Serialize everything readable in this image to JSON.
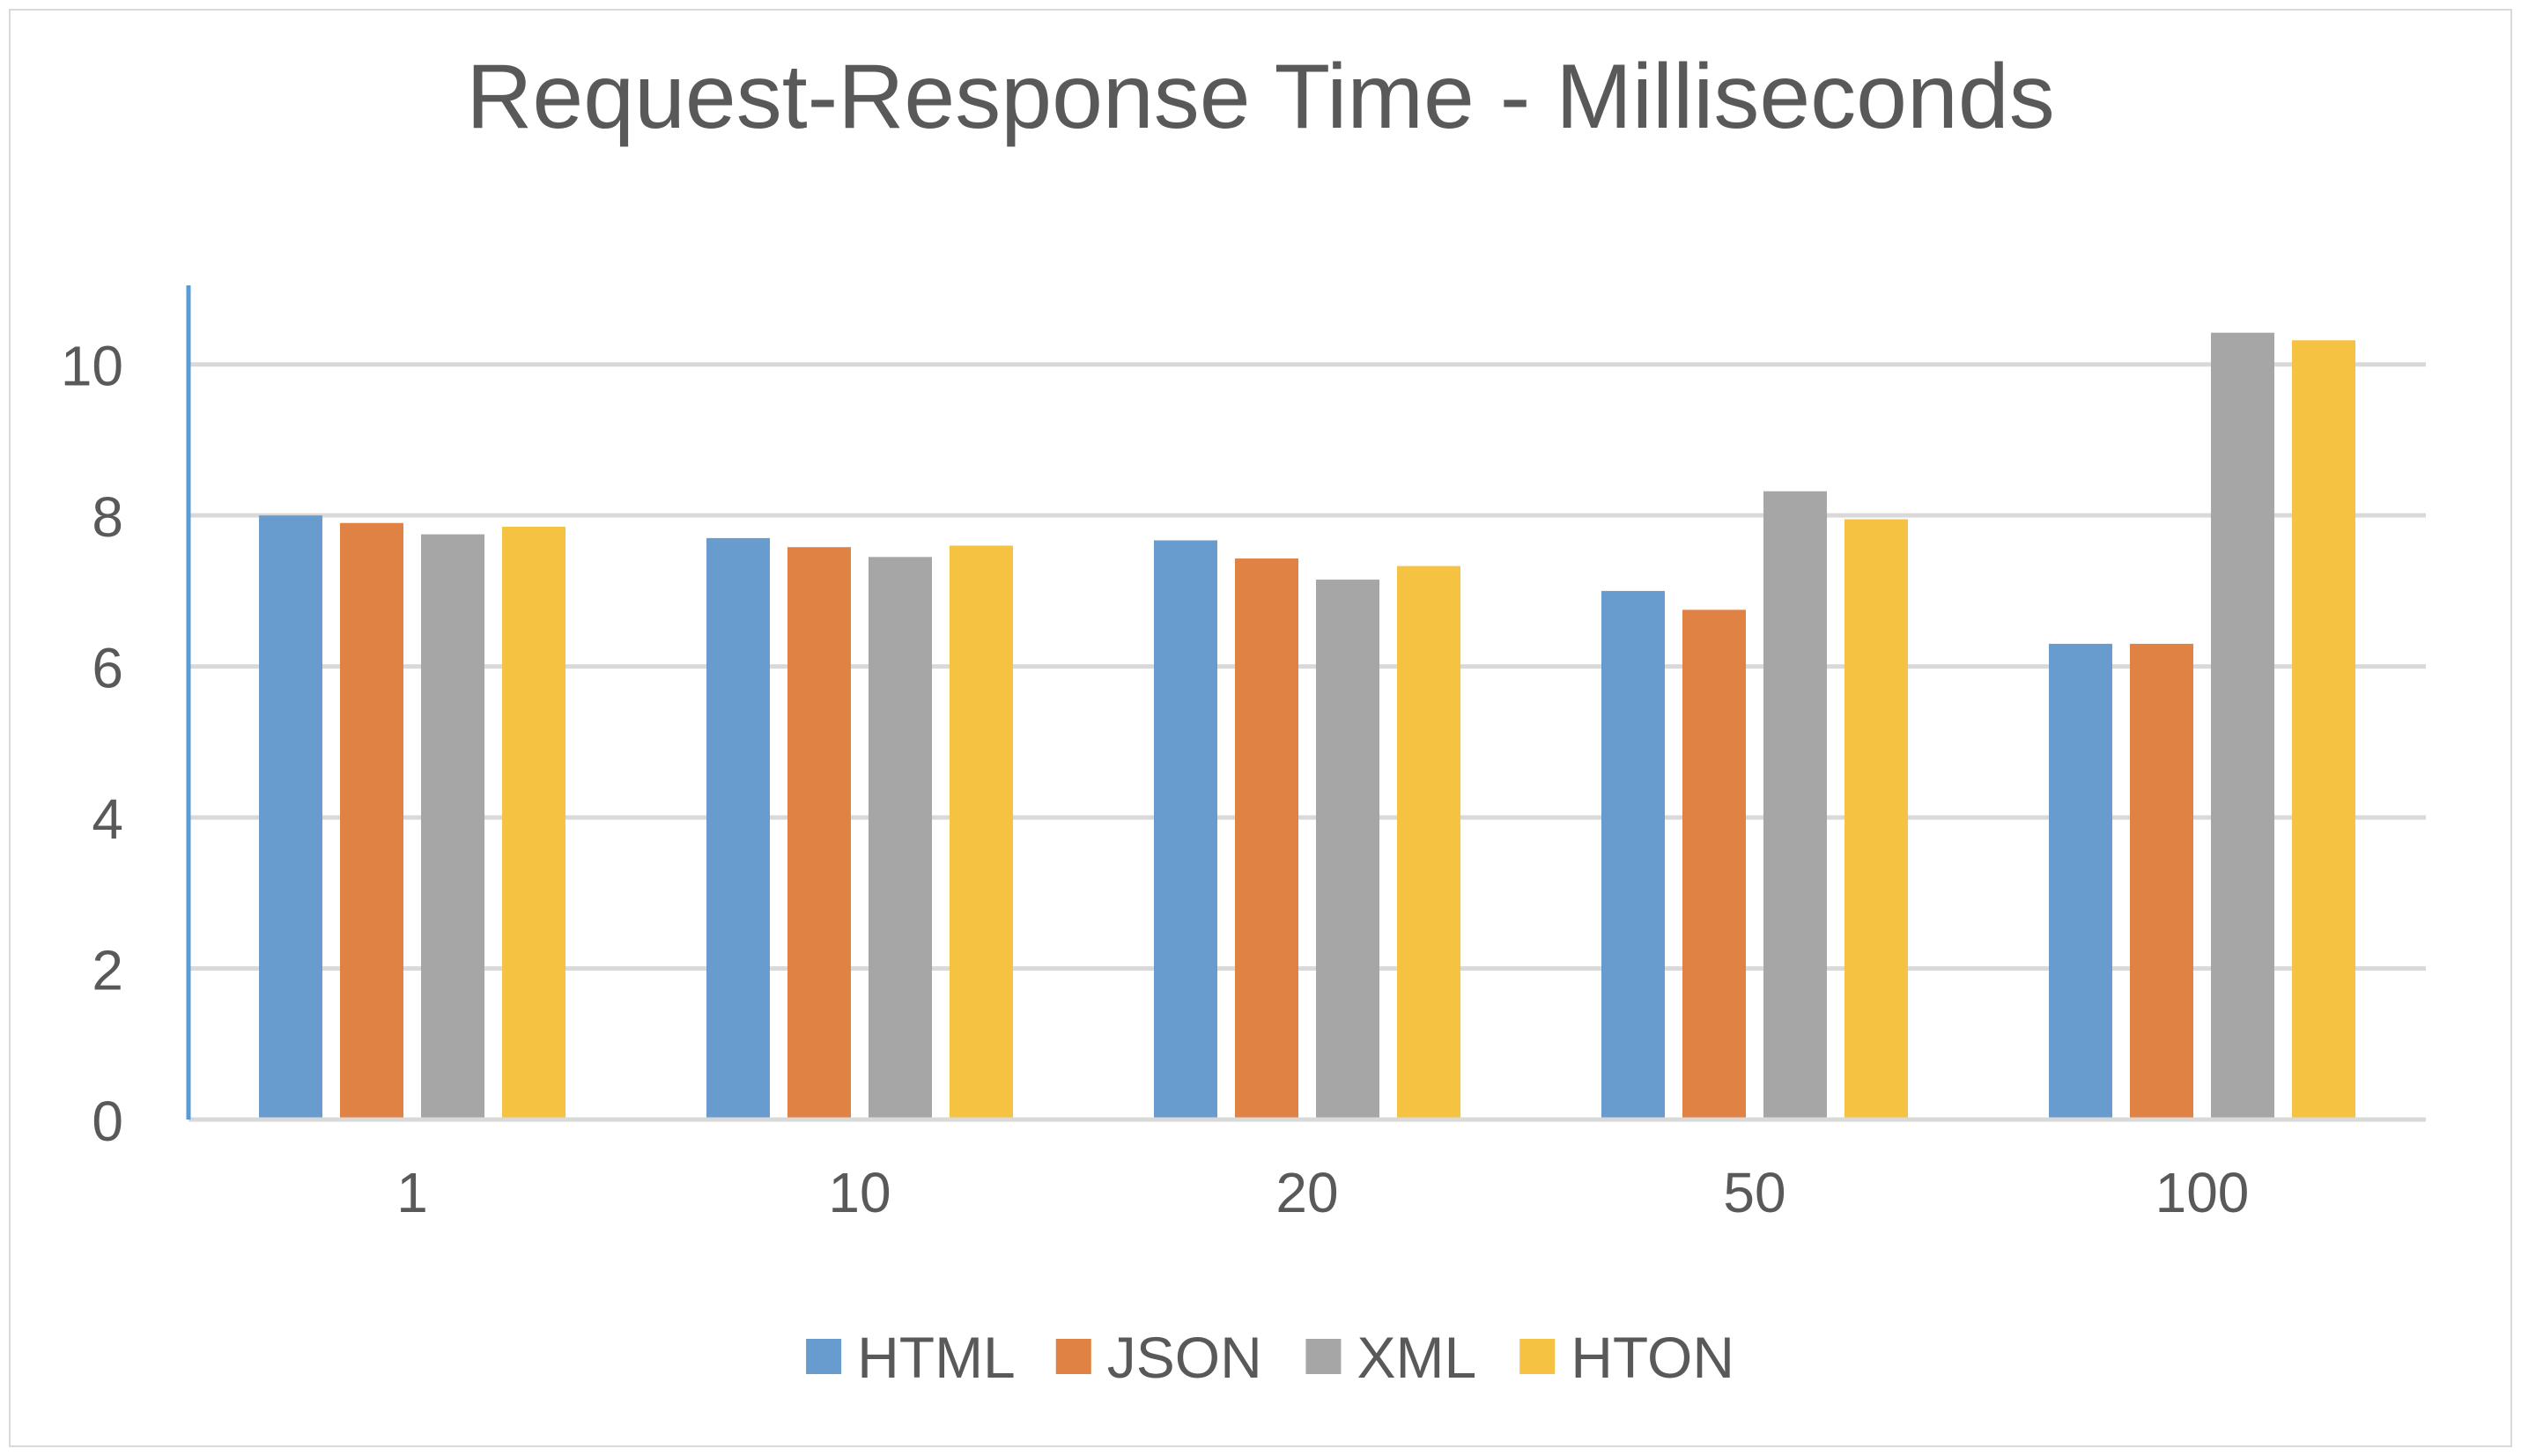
{
  "chart_data": {
    "type": "bar",
    "title": "Request-Response Time - Milliseconds",
    "xlabel": "",
    "ylabel": "",
    "categories": [
      "1",
      "10",
      "20",
      "50",
      "100"
    ],
    "series": [
      {
        "name": "HTML",
        "color": "#689ccf",
        "values": [
          8.0,
          7.7,
          7.67,
          7.0,
          6.3
        ]
      },
      {
        "name": "JSON",
        "color": "#e08244",
        "values": [
          7.9,
          7.58,
          7.43,
          6.75,
          6.3
        ]
      },
      {
        "name": "XML",
        "color": "#a6a6a6",
        "values": [
          7.75,
          7.45,
          7.15,
          8.32,
          10.42
        ]
      },
      {
        "name": "HTON",
        "color": "#f6c242",
        "values": [
          7.85,
          7.6,
          7.33,
          7.95,
          10.32
        ]
      }
    ],
    "ylim": [
      0,
      11
    ],
    "yticks": [
      0,
      2,
      4,
      6,
      8,
      10
    ],
    "grid": true,
    "legend_position": "bottom",
    "axis_color": "#5b9bd5",
    "grid_color": "#d9d9d9"
  }
}
